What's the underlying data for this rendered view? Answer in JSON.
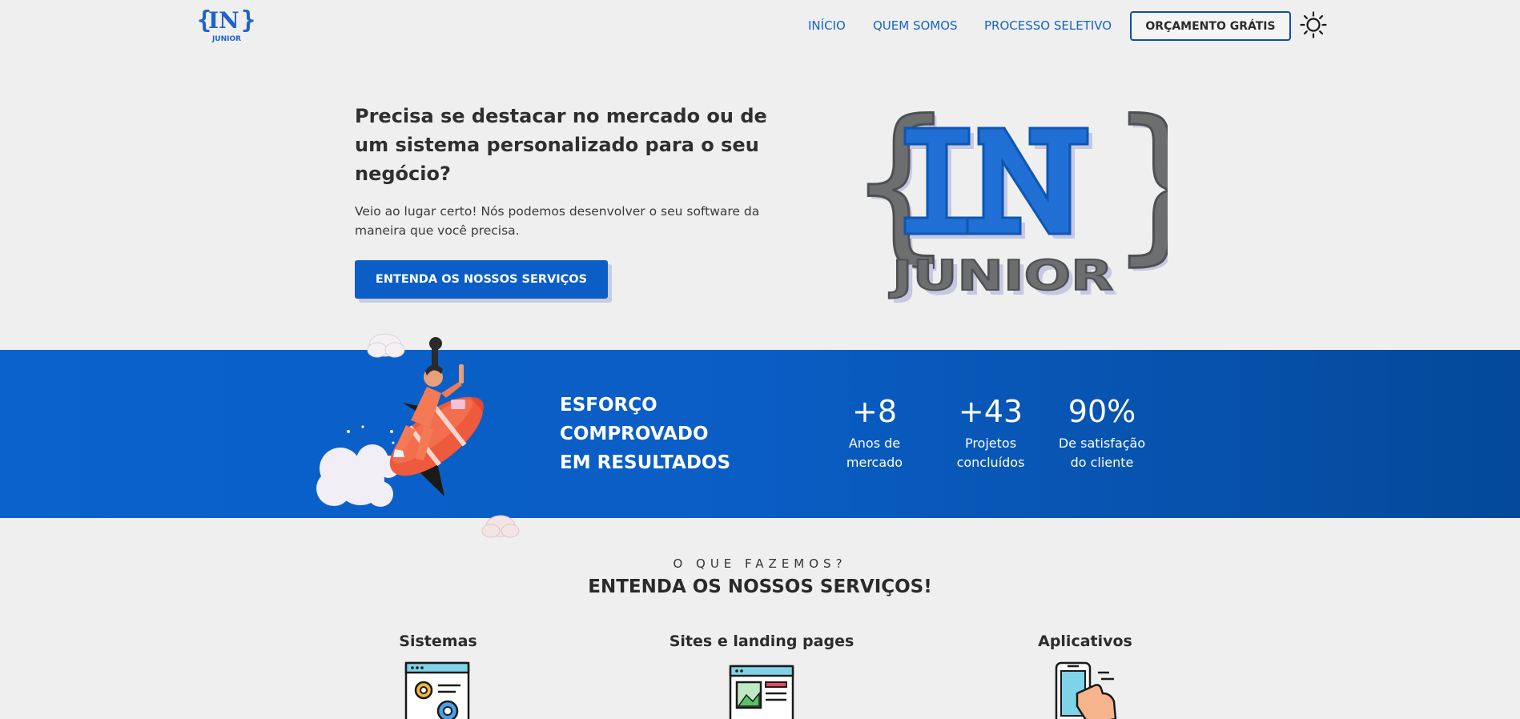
{
  "nav": {
    "logo": {
      "brace_open": "{",
      "brace_close": "}",
      "mark": "IN",
      "sub": "JUNIOR"
    },
    "links": [
      "INÍCIO",
      "QUEM SOMOS",
      "PROCESSO SELETIVO"
    ],
    "cta": "ORÇAMENTO GRÁTIS",
    "theme_icon": "sun-icon"
  },
  "hero": {
    "title": "Precisa se destacar no mercado ou de um sistema personalizado para o seu negócio?",
    "subtitle": "Veio ao lugar certo! Nós podemos desenvolver o seu software da maneira que você precisa.",
    "button": "ENTENDA OS NOSSOS SERVIÇOS",
    "logo": {
      "brace_open": "{",
      "brace_close": "}",
      "mark": "IN",
      "sub": "JUNIOR"
    }
  },
  "results": {
    "title_lines": [
      "ESFORÇO",
      "COMPROVADO",
      "EM RESULTADOS"
    ],
    "stats": [
      {
        "value": "+8",
        "label_1": "Anos de",
        "label_2": "mercado"
      },
      {
        "value": "+43",
        "label_1": "Projetos",
        "label_2": "concluídos"
      },
      {
        "value": "90%",
        "label_1": "De satisfação",
        "label_2": "do cliente"
      }
    ]
  },
  "services": {
    "eyebrow": "O QUE FAZEMOS?",
    "title": "ENTENDA OS NOSSOS SERVIÇOS!",
    "items": [
      {
        "title": "Sistemas",
        "icon": "system-gears-icon"
      },
      {
        "title": "Sites e landing pages",
        "icon": "website-icon"
      },
      {
        "title": "Aplicativos",
        "icon": "mobile-app-icon"
      }
    ]
  },
  "colors": {
    "primary": "#0b5ec6",
    "primary_dark": "#04499a",
    "background": "#efefef",
    "text": "#2f2f2f",
    "logo_gray": "#6d6d6d"
  }
}
